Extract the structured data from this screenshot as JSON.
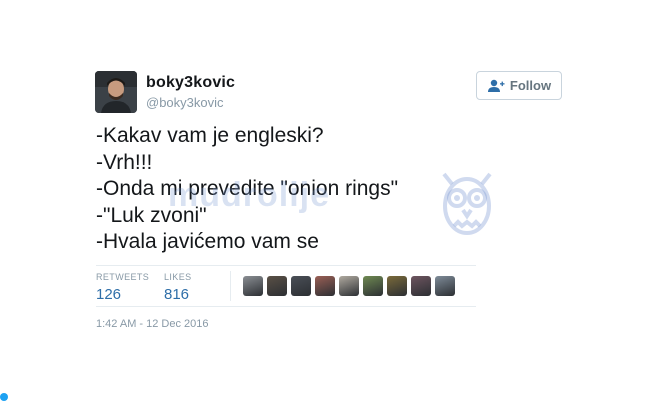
{
  "author": {
    "display_name": "boky3kovic",
    "handle": "@boky3kovic"
  },
  "follow_button": {
    "label": "Follow",
    "icon": "follow-user-icon"
  },
  "tweet": {
    "lines": [
      "-Kakav vam je engleski?",
      "-Vrh!!!",
      "-Onda mi prevedite \"onion rings\"",
      "-\"Luk zvoni\"",
      "-Hvala javićemo vam se"
    ]
  },
  "watermark": {
    "text": "mudrolije"
  },
  "stats": {
    "retweets_label": "RETWEETS",
    "retweets_value": "126",
    "likes_label": "LIKES",
    "likes_value": "816"
  },
  "likers": {
    "count": 9,
    "colors": [
      "#8b8f94",
      "#5a5046",
      "#4a4f57",
      "#9a5f55",
      "#b0aaa0",
      "#6f8a52",
      "#7a6a3a",
      "#6e5560",
      "#7f8c99"
    ]
  },
  "timestamp": "1:42 AM - 12 Dec 2016",
  "colors": {
    "link_blue": "#2e6ea8",
    "muted_gray": "#8899a6",
    "text_dark": "#14171a"
  }
}
